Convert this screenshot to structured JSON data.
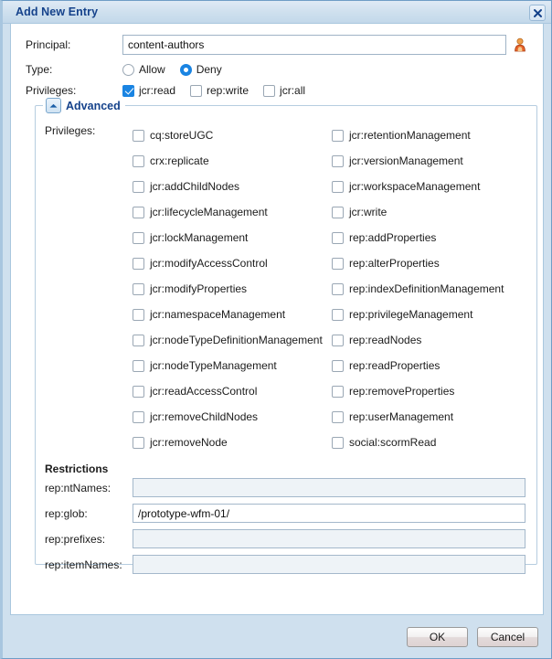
{
  "window": {
    "title": "Add New Entry",
    "close_icon": "close-icon"
  },
  "form": {
    "principal": {
      "label": "Principal:",
      "value": "content-authors",
      "placeholder": "",
      "picker_icon": "user-icon"
    },
    "type": {
      "label": "Type:",
      "options": [
        {
          "label": "Allow",
          "selected": false
        },
        {
          "label": "Deny",
          "selected": true
        }
      ]
    },
    "privileges": {
      "label": "Privileges:",
      "options": [
        {
          "label": "jcr:read",
          "checked": true
        },
        {
          "label": "rep:write",
          "checked": false
        },
        {
          "label": "jcr:all",
          "checked": false
        }
      ]
    }
  },
  "advanced": {
    "legend": "Advanced",
    "toggle_icon": "chevron-up-icon",
    "expanded": true,
    "privileges_label": "Privileges:",
    "privileges_left": [
      {
        "label": "cq:storeUGC",
        "checked": false
      },
      {
        "label": "crx:replicate",
        "checked": false
      },
      {
        "label": "jcr:addChildNodes",
        "checked": false
      },
      {
        "label": "jcr:lifecycleManagement",
        "checked": false
      },
      {
        "label": "jcr:lockManagement",
        "checked": false
      },
      {
        "label": "jcr:modifyAccessControl",
        "checked": false
      },
      {
        "label": "jcr:modifyProperties",
        "checked": false
      },
      {
        "label": "jcr:namespaceManagement",
        "checked": false
      },
      {
        "label": "jcr:nodeTypeDefinitionManagement",
        "checked": false
      },
      {
        "label": "jcr:nodeTypeManagement",
        "checked": false
      },
      {
        "label": "jcr:readAccessControl",
        "checked": false
      },
      {
        "label": "jcr:removeChildNodes",
        "checked": false
      },
      {
        "label": "jcr:removeNode",
        "checked": false
      }
    ],
    "privileges_right": [
      {
        "label": "jcr:retentionManagement",
        "checked": false
      },
      {
        "label": "jcr:versionManagement",
        "checked": false
      },
      {
        "label": "jcr:workspaceManagement",
        "checked": false
      },
      {
        "label": "jcr:write",
        "checked": false
      },
      {
        "label": "rep:addProperties",
        "checked": false
      },
      {
        "label": "rep:alterProperties",
        "checked": false
      },
      {
        "label": "rep:indexDefinitionManagement",
        "checked": false
      },
      {
        "label": "rep:privilegeManagement",
        "checked": false
      },
      {
        "label": "rep:readNodes",
        "checked": false
      },
      {
        "label": "rep:readProperties",
        "checked": false
      },
      {
        "label": "rep:removeProperties",
        "checked": false
      },
      {
        "label": "rep:userManagement",
        "checked": false
      },
      {
        "label": "social:scormRead",
        "checked": false
      }
    ],
    "restrictions_title": "Restrictions",
    "restrictions": [
      {
        "label": "rep:ntNames:",
        "value": ""
      },
      {
        "label": "rep:glob:",
        "value": "/prototype-wfm-01/"
      },
      {
        "label": "rep:prefixes:",
        "value": ""
      },
      {
        "label": "rep:itemNames:",
        "value": ""
      }
    ]
  },
  "footer": {
    "ok_label": "OK",
    "cancel_label": "Cancel"
  },
  "colors": {
    "title_text": "#15428b",
    "accent": "#1a84e2",
    "chrome": "#cfe0ee",
    "border": "#a9c7de"
  }
}
